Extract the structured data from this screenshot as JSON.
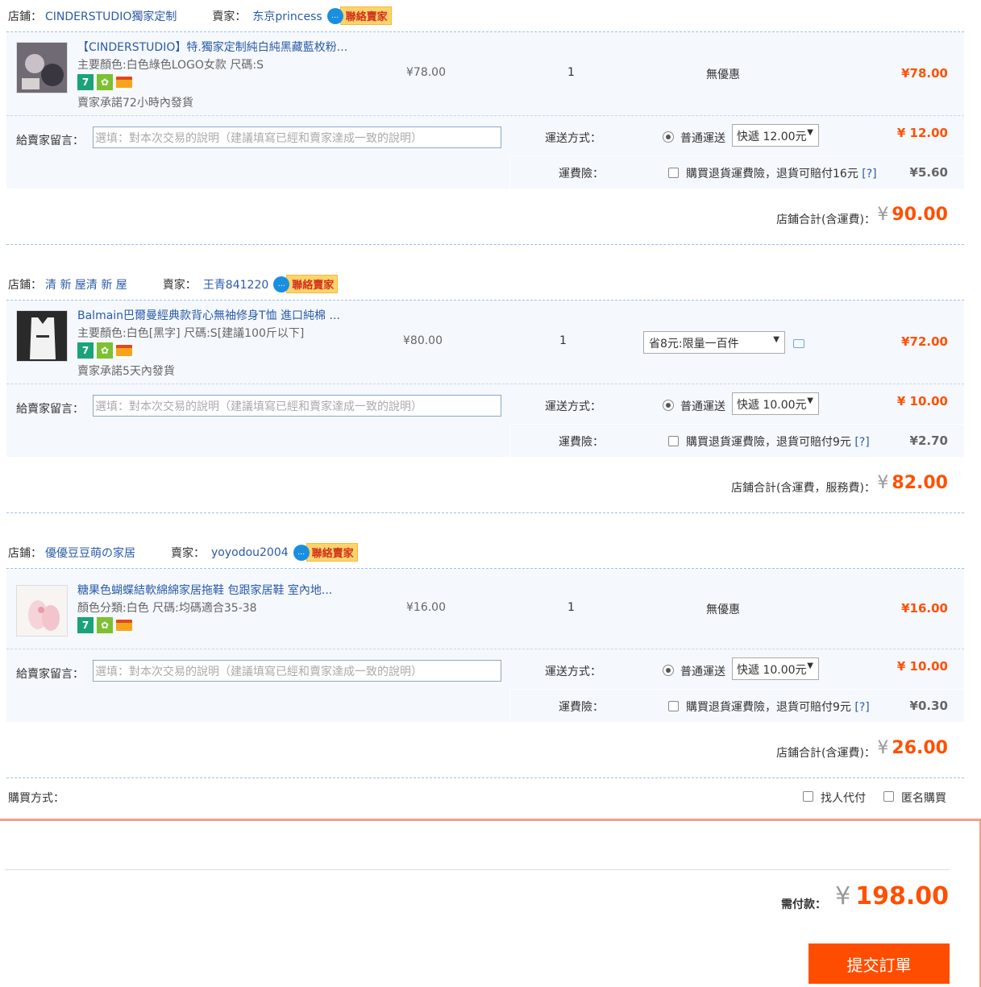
{
  "labels": {
    "store": "店鋪：",
    "seller": "賣家：",
    "contact_seller": "聯絡賣家",
    "message_to_seller": "給賣家留言：",
    "message_placeholder": "選填：對本次交易的說明（建議填寫已經和賣家達成一致的說明）",
    "shipping_method": "運送方式：",
    "normal_shipping": "普通運送",
    "shipping_insurance": "運費險：",
    "help_link": "[?]"
  },
  "stores": [
    {
      "store_name": "CINDERSTUDIO獨家定制",
      "seller_name": "东京princess",
      "item": {
        "title": "【CINDERSTUDIO】特.獨家定制純白純黑藏藍枚粉...",
        "spec": "主要顏色:白色綠色LOGO女款   尺碼:S",
        "ship_promise": "賣家承諾72小時內發貨",
        "unit_price": "¥78.00",
        "quantity": "1",
        "discount": "無優惠",
        "subtotal": "¥78.00"
      },
      "shipping_option": "快遞 12.00元",
      "shipping_fee": "¥ 12.00",
      "insurance_text": "購買退貨運費險，退貨可賠付16元",
      "insurance_fee": "¥5.60",
      "total_label": "店鋪合計(含運費)：",
      "total_value": "90.00"
    },
    {
      "store_name": "清 新 屋清 新 屋",
      "seller_name": "王青841220",
      "item": {
        "title": "Balmain巴爾曼經典款背心無袖修身T恤 進口純棉 ...",
        "spec": "主要顏色:白色[黑字]   尺碼:S[建議100斤以下]",
        "ship_promise": "賣家承諾5天內發貨",
        "unit_price": "¥80.00",
        "quantity": "1",
        "promo_select": "省8元:限量一百件",
        "subtotal": "¥72.00"
      },
      "shipping_option": "快遞 10.00元",
      "shipping_fee": "¥ 10.00",
      "insurance_text": "購買退貨運費險，退貨可賠付9元",
      "insurance_fee": "¥2.70",
      "total_label": "店鋪合計(含運費，服務費)：",
      "total_value": "82.00"
    },
    {
      "store_name": "優優豆豆萌の家居",
      "seller_name": "yoyodou2004",
      "item": {
        "title": "糖果色蝴蝶結軟綿綿家居拖鞋 包跟家居鞋 室內地...",
        "spec": "顏色分類:白色   尺碼:均碼適合35-38",
        "unit_price": "¥16.00",
        "quantity": "1",
        "discount": "無優惠",
        "subtotal": "¥16.00"
      },
      "shipping_option": "快遞 10.00元",
      "shipping_fee": "¥ 10.00",
      "insurance_text": "購買退貨運費險，退貨可賠付9元",
      "insurance_fee": "¥0.30",
      "total_label": "店鋪合計(含運費)：",
      "total_value": "26.00"
    }
  ],
  "buy_mode": {
    "label": "購買方式：",
    "option_proxy_pay": "找人代付",
    "option_anonymous": "匿名購買"
  },
  "order": {
    "pay_label": "需付款：",
    "currency": "¥",
    "pay_value": "198.00",
    "submit_label": "提交訂單"
  },
  "colors": {
    "accent": "#ff5000",
    "link": "#2b5ba8",
    "row_bg": "#f5f8fd",
    "submit_bg": "#ff4d00"
  }
}
